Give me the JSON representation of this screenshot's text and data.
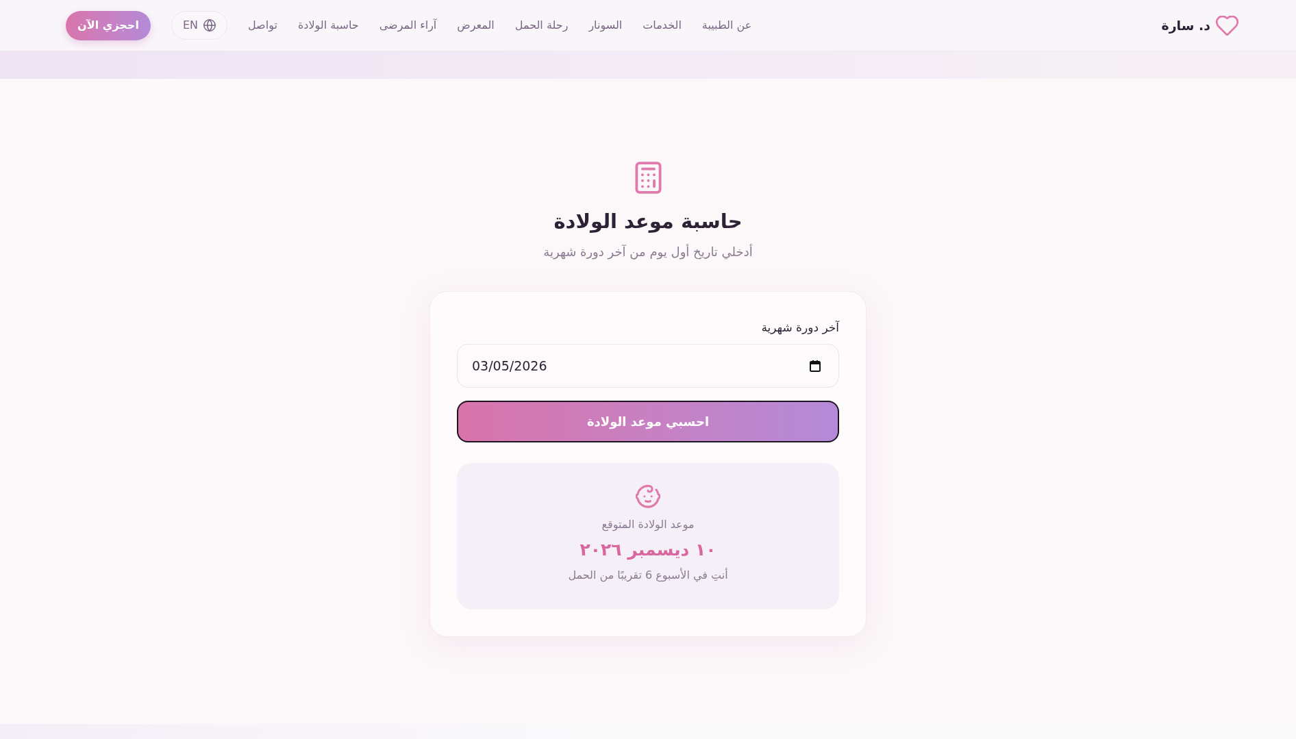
{
  "navbar": {
    "logo": {
      "text": "د. سارة"
    },
    "links": [
      {
        "label": "عن الطبيبة"
      },
      {
        "label": "الخدمات"
      },
      {
        "label": "السونار"
      },
      {
        "label": "رحلة الحمل"
      },
      {
        "label": "المعرض"
      },
      {
        "label": "آراء المرضى"
      },
      {
        "label": "حاسبة الولادة"
      },
      {
        "label": "تواصل"
      }
    ],
    "language_button": {
      "label": "EN"
    },
    "cta_button": {
      "label": "احجزي الآن"
    }
  },
  "calculator": {
    "title": "حاسبة موعد الولادة",
    "subtitle": "أدخلي تاريخ أول يوم من آخر دورة شهرية",
    "form": {
      "label": "آخر دورة شهرية",
      "date_field": {
        "value": "03/05/2026"
      },
      "submit_button": {
        "label": "احسبي موعد الولادة"
      }
    },
    "result": {
      "label": "موعد الولادة المتوقع",
      "due_date": "١٠ ديسمبر ٢٠٢٦",
      "note": "أنتِ في الأسبوع 6 تقريبًا من الحمل"
    }
  }
}
